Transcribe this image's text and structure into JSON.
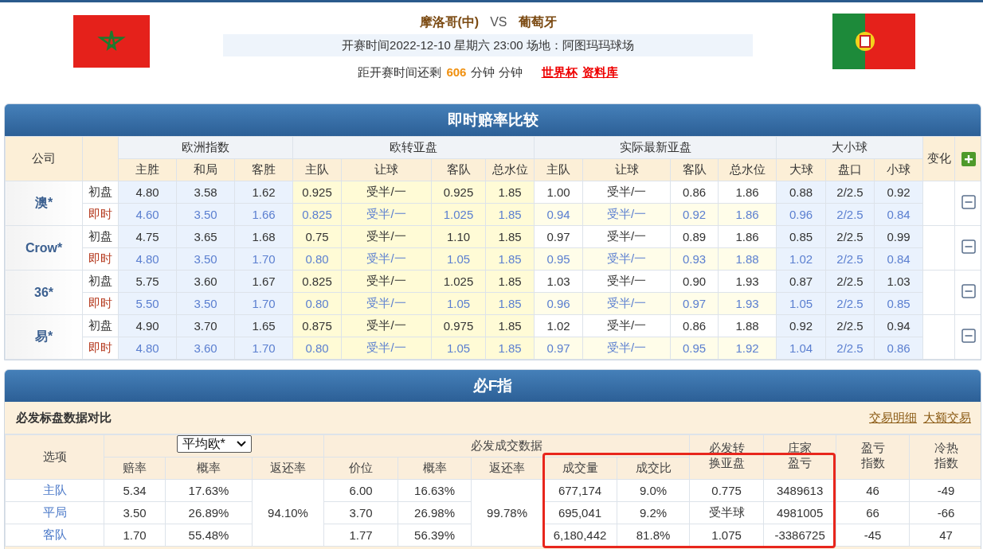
{
  "match": {
    "home": "摩洛哥(中)",
    "vs": "VS",
    "away": "葡萄牙",
    "kickoff": "开赛时间2022-12-10 星期六 23:00 场地：阿图玛玛球场",
    "countdown_prefix": "距开赛时间还剩",
    "countdown_value": "606",
    "countdown_suffix": "分钟 分钟",
    "links": [
      "世界杯",
      "资料库"
    ]
  },
  "odds": {
    "title": "即时赔率比较",
    "company_header": "公司",
    "change_header": "变化",
    "groups": [
      {
        "label": "欧洲指数",
        "columns": [
          "主胜",
          "和局",
          "客胜"
        ]
      },
      {
        "label": "欧转亚盘",
        "columns": [
          "主队",
          "让球",
          "客队",
          "总水位"
        ]
      },
      {
        "label": "实际最新亚盘",
        "columns": [
          "主队",
          "让球",
          "客队",
          "总水位"
        ]
      },
      {
        "label": "大小球",
        "columns": [
          "大球",
          "盘口",
          "小球"
        ]
      }
    ],
    "companies": [
      {
        "name": "澳*",
        "rows": [
          {
            "kind": "initial",
            "label": "初盘",
            "values": [
              "4.80",
              "3.58",
              "1.62",
              "0.925",
              "受半/一",
              "0.925",
              "1.85",
              "1.00",
              "受半/一",
              "0.86",
              "1.86",
              "0.88",
              "2/2.5",
              "0.92"
            ]
          },
          {
            "kind": "live",
            "label": "即时",
            "values": [
              "4.60",
              "3.50",
              "1.66",
              "0.825",
              "受半/一",
              "1.025",
              "1.85",
              "0.94",
              "受半/一",
              "0.92",
              "1.86",
              "0.96",
              "2/2.5",
              "0.84"
            ]
          }
        ]
      },
      {
        "name": "Crow*",
        "rows": [
          {
            "kind": "initial",
            "label": "初盘",
            "values": [
              "4.75",
              "3.65",
              "1.68",
              "0.75",
              "受半/一",
              "1.10",
              "1.85",
              "0.97",
              "受半/一",
              "0.89",
              "1.86",
              "0.85",
              "2/2.5",
              "0.99"
            ]
          },
          {
            "kind": "live",
            "label": "即时",
            "values": [
              "4.80",
              "3.50",
              "1.70",
              "0.80",
              "受半/一",
              "1.05",
              "1.85",
              "0.95",
              "受半/一",
              "0.93",
              "1.88",
              "1.02",
              "2/2.5",
              "0.84"
            ]
          }
        ]
      },
      {
        "name": "36*",
        "rows": [
          {
            "kind": "initial",
            "label": "初盘",
            "values": [
              "5.75",
              "3.60",
              "1.67",
              "0.825",
              "受半/一",
              "1.025",
              "1.85",
              "1.03",
              "受半/一",
              "0.90",
              "1.93",
              "0.87",
              "2/2.5",
              "1.03"
            ]
          },
          {
            "kind": "live",
            "label": "即时",
            "values": [
              "5.50",
              "3.50",
              "1.70",
              "0.80",
              "受半/一",
              "1.05",
              "1.85",
              "0.96",
              "受半/一",
              "0.97",
              "1.93",
              "1.05",
              "2/2.5",
              "0.85"
            ]
          }
        ]
      },
      {
        "name": "易*",
        "rows": [
          {
            "kind": "initial",
            "label": "初盘",
            "values": [
              "4.90",
              "3.70",
              "1.65",
              "0.875",
              "受半/一",
              "0.975",
              "1.85",
              "1.02",
              "受半/一",
              "0.86",
              "1.88",
              "0.92",
              "2/2.5",
              "0.94"
            ]
          },
          {
            "kind": "live",
            "label": "即时",
            "values": [
              "4.80",
              "3.60",
              "1.70",
              "0.80",
              "受半/一",
              "1.05",
              "1.85",
              "0.97",
              "受半/一",
              "0.95",
              "1.92",
              "1.04",
              "2/2.5",
              "0.86"
            ]
          }
        ]
      }
    ]
  },
  "betfair": {
    "title": "必F指",
    "subtitle": "必发标盘数据对比",
    "links": [
      "交易明细",
      "大额交易"
    ],
    "option_header": "选项",
    "select_value": "平均欧*",
    "avg_columns": [
      "赔率",
      "概率",
      "返还率"
    ],
    "trade_group": "必发成交数据",
    "trade_columns": [
      "价位",
      "概率",
      "返还率",
      "成交量",
      "成交比"
    ],
    "extra_headers": [
      [
        "必发转",
        "换亚盘"
      ],
      [
        "庄家",
        "盈亏"
      ],
      [
        "盈亏",
        "指数"
      ],
      [
        "冷热",
        "指数"
      ]
    ],
    "avg_return": "94.10%",
    "trade_return": "99.78%",
    "rows": [
      {
        "option": "主队",
        "odds": "5.34",
        "prob": "17.63%",
        "price": "6.00",
        "trade_prob": "16.63%",
        "volume": "677,174",
        "ratio": "9.0%",
        "asian": "0.775",
        "profit": "3489613",
        "pl_index": "46",
        "hot_index": "-49"
      },
      {
        "option": "平局",
        "odds": "3.50",
        "prob": "26.89%",
        "price": "3.70",
        "trade_prob": "26.98%",
        "volume": "695,041",
        "ratio": "9.2%",
        "asian": "受半球",
        "profit": "4981005",
        "pl_index": "66",
        "hot_index": "-66"
      },
      {
        "option": "客队",
        "odds": "1.70",
        "prob": "55.48%",
        "price": "1.77",
        "trade_prob": "56.39%",
        "volume": "6,180,442",
        "ratio": "81.8%",
        "asian": "1.075",
        "profit": "-3386725",
        "pl_index": "-45",
        "hot_index": "47"
      }
    ]
  }
}
